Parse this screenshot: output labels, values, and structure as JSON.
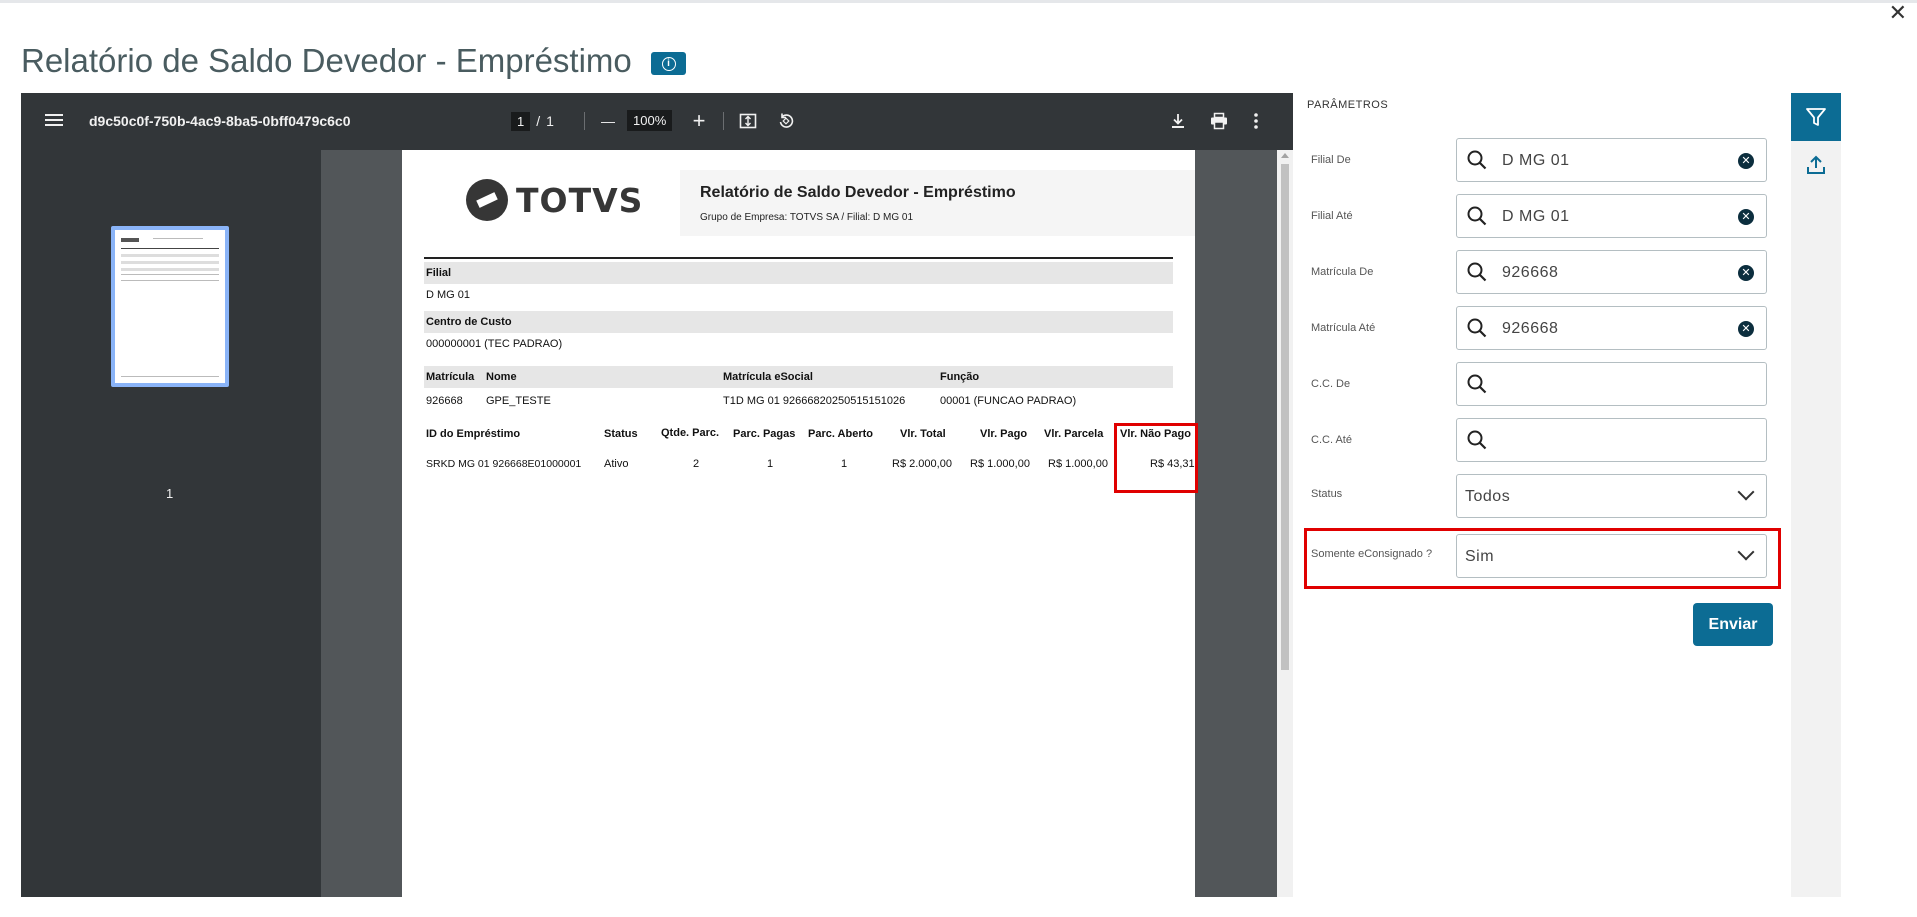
{
  "window": {
    "close_glyph": "✕"
  },
  "page": {
    "title": "Relatório de Saldo Devedor - Empréstimo",
    "info_icon": "info-icon"
  },
  "viewer": {
    "filename": "d9c50c0f-750b-4ac9-8ba5-0bff0479c6c0",
    "current_page": "1",
    "page_separator": "/",
    "total_pages": "1",
    "zoom": "100%",
    "zoom_out_glyph": "—",
    "zoom_in_glyph": "+",
    "thumbnail_label": "1"
  },
  "report": {
    "logo_text": "TOTVS",
    "title": "Relatório de Saldo Devedor - Empréstimo",
    "subtitle": "Grupo de Empresa: TOTVS SA / Filial: D MG 01",
    "filial_label": "Filial",
    "filial_value": "D MG 01",
    "cc_label": "Centro de Custo",
    "cc_value": "000000001 (TEC PADRAO)",
    "emp_headers": {
      "matricula": "Matrícula",
      "nome": "Nome",
      "matricula_esocial": "Matrícula eSocial",
      "funcao": "Função"
    },
    "emp_values": {
      "matricula": "926668",
      "nome": "GPE_TESTE",
      "matricula_esocial": "T1D MG 01 92666820250515151026",
      "funcao": "00001 (FUNCAO PADRAO)"
    },
    "loan_headers": {
      "id": "ID do Empréstimo",
      "status": "Status",
      "qtde": "Qtde. Parc.",
      "pagas": "Parc. Pagas",
      "aberto": "Parc. Aberto",
      "total": "Vlr. Total",
      "pago": "Vlr. Pago",
      "parcela": "Vlr. Parcela",
      "nao_pago": "Vlr. Não Pago"
    },
    "loan_row": {
      "id": "SRKD MG 01 926668E01000001",
      "status": "Ativo",
      "qtde": "2",
      "pagas": "1",
      "aberto": "1",
      "total": "R$ 2.000,00",
      "pago": "R$ 1.000,00",
      "parcela": "R$ 1.000,00",
      "nao_pago": "R$ 43,31"
    }
  },
  "params": {
    "title": "PARÂMETROS",
    "fields": [
      {
        "label": "Filial De",
        "value": "D MG 01"
      },
      {
        "label": "Filial Até",
        "value": "D MG 01"
      },
      {
        "label": "Matrícula De",
        "value": "926668"
      },
      {
        "label": "Matrícula Até",
        "value": "926668"
      },
      {
        "label": "C.C. De",
        "value": ""
      },
      {
        "label": "C.C. Até",
        "value": ""
      }
    ],
    "status_label": "Status",
    "status_value": "Todos",
    "econsignado_label": "Somente eConsignado ?",
    "econsignado_value": "Sim",
    "send_label": "Enviar"
  },
  "colors": {
    "brand": "#0c6c94",
    "highlight": "#e00000",
    "viewer_bg": "#525659",
    "toolbar_bg": "#323639"
  }
}
